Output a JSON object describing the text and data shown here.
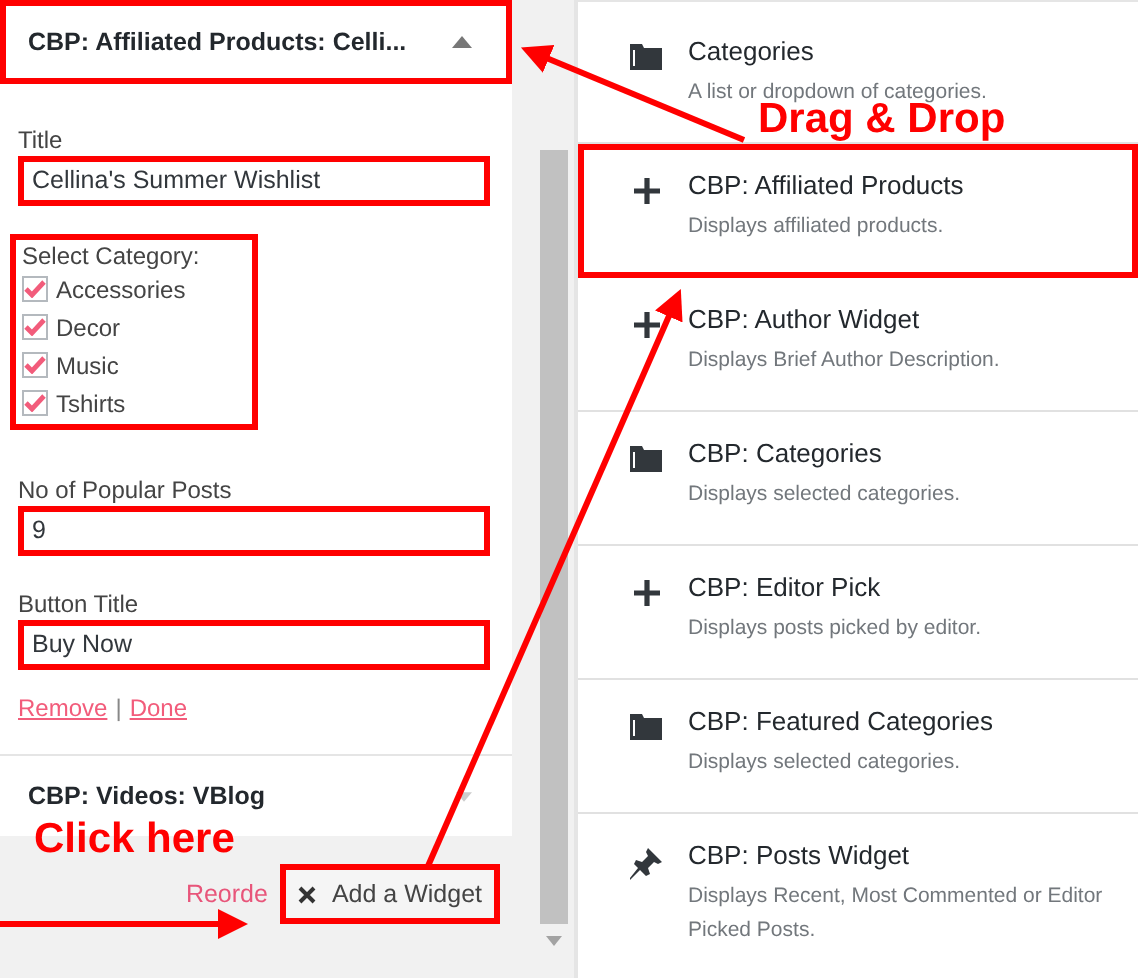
{
  "widget_form": {
    "header": {
      "title": "CBP: Affiliated Products: Celli...",
      "expanded": true,
      "highlighted": true
    },
    "fields": [
      {
        "label": "Title",
        "value": "Cellina's Summer Wishlist",
        "highlighted": true
      }
    ],
    "category_group": {
      "label": "Select Category:",
      "highlighted": true,
      "categories": [
        {
          "label": "Accessories",
          "checked": true
        },
        {
          "label": "Decor",
          "checked": true
        },
        {
          "label": "Music",
          "checked": true
        },
        {
          "label": "Tshirts",
          "checked": true
        }
      ]
    },
    "fields_after": [
      {
        "label": "No of Popular Posts",
        "value": "9",
        "highlighted": true
      },
      {
        "label": "Button Title",
        "value": "Buy Now",
        "highlighted": true
      }
    ],
    "links": [
      "Remove",
      "Done"
    ],
    "separator": "|",
    "collapsed_widget": {
      "title": "CBP: Videos: VBlog",
      "expanded": false
    },
    "reorder_link": "Reorde",
    "add_button": {
      "label": "Add a Widget",
      "highlighted": true
    }
  },
  "widget_list": [
    {
      "kind": "folder",
      "title": "Categories",
      "description": "A list or dropdown of categories.",
      "highlighted": false
    },
    {
      "kind": "plus",
      "title": "CBP: Affiliated Products",
      "description": "Displays affiliated products.",
      "highlighted": true
    },
    {
      "kind": "plus",
      "title": "CBP: Author Widget",
      "description": "Displays Brief Author Description.",
      "highlighted": false
    },
    {
      "kind": "folder",
      "title": "CBP: Categories",
      "description": "Displays selected categories.",
      "highlighted": false
    },
    {
      "kind": "plus",
      "title": "CBP: Editor Pick",
      "description": "Displays posts picked by editor.",
      "highlighted": false
    },
    {
      "kind": "folder",
      "title": "CBP: Featured Categories",
      "description": "Displays selected categories.",
      "highlighted": false
    },
    {
      "kind": "pin",
      "title": "CBP: Posts Widget",
      "description": "Displays Recent, Most Commented or Editor Picked Posts.",
      "highlighted": false
    }
  ],
  "annotations": [
    {
      "text": "Drag & Drop"
    },
    {
      "text": "Click here"
    }
  ]
}
